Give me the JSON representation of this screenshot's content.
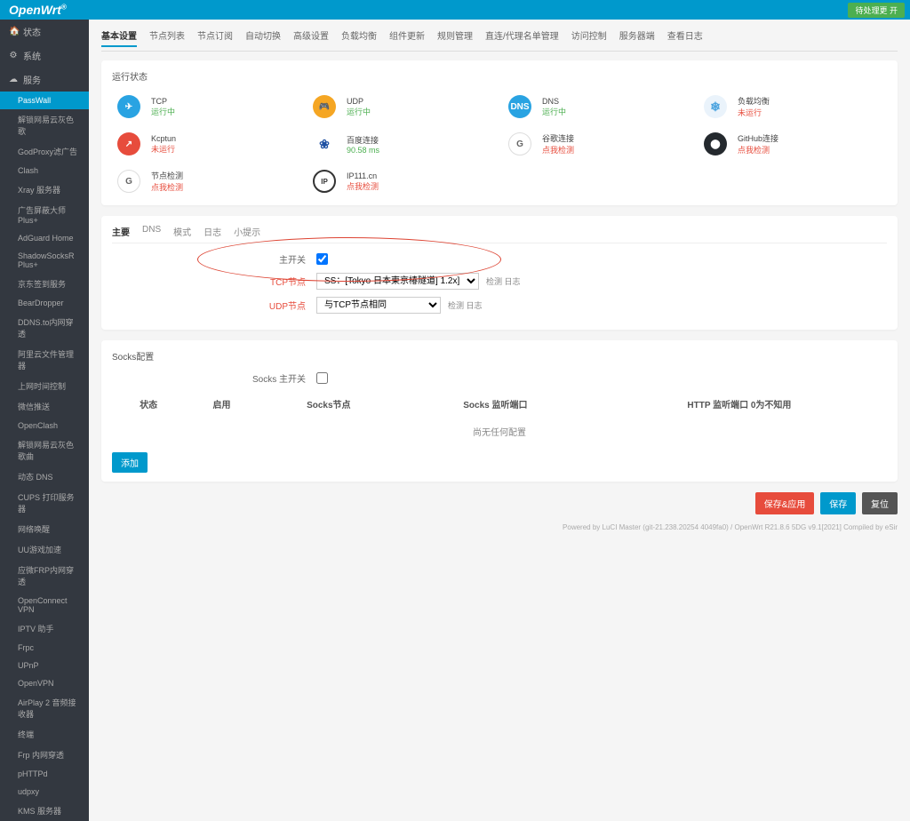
{
  "brand": "OpenWrt",
  "top_button": "待处理更 开",
  "side_cats": [
    {
      "icon": "🏠",
      "label": "状态"
    },
    {
      "icon": "⚙",
      "label": "系统"
    },
    {
      "icon": "☁",
      "label": "服务"
    }
  ],
  "side_subs": [
    "PassWall",
    "解锁网易云灰色歌",
    "GodProxy滤广告",
    "Clash",
    "Xray 服务器",
    "广告屏蔽大师 Plus+",
    "AdGuard Home",
    "ShadowSocksR Plus+",
    "京东签到服务",
    "BearDropper",
    "DDNS.to内网穿透",
    "阿里云文件管理器",
    "上网时间控制",
    "微信推送",
    "OpenClash",
    "解锁网易云灰色歌曲",
    "动态 DNS",
    "CUPS 打印服务器",
    "网络唤醒",
    "UU游戏加速",
    "应微FRP内网穿透",
    "OpenConnect VPN",
    "IPTV 助手",
    "Frpc",
    "UPnP",
    "OpenVPN",
    "AirPlay 2 音频接收器",
    "终端",
    "Frp 内网穿透",
    "pHTTPd",
    "udpxy",
    "KMS 服务器"
  ],
  "active_sub": 0,
  "tabs": [
    "基本设置",
    "节点列表",
    "节点订阅",
    "自动切换",
    "高级设置",
    "负载均衡",
    "组件更新",
    "规则管理",
    "直连/代理名单管理",
    "访问控制",
    "服务器端",
    "查看日志"
  ],
  "status_title": "运行状态",
  "status": [
    {
      "iconText": "✈",
      "cls": "c-blue",
      "t1": "TCP",
      "t2": "运行中",
      "col": "green"
    },
    {
      "iconText": "🎮",
      "cls": "c-orange",
      "t1": "UDP",
      "t2": "运行中",
      "col": "green"
    },
    {
      "iconText": "DNS",
      "cls": "c-blue",
      "t1": "DNS",
      "t2": "运行中",
      "col": "green"
    },
    {
      "iconText": "❄",
      "cls": "c-snow",
      "t1": "负载均衡",
      "t2": "未运行",
      "col": "red"
    },
    {
      "iconText": "↗",
      "cls": "c-red",
      "t1": "Kcptun",
      "t2": "未运行",
      "col": "red"
    },
    {
      "iconText": "❀",
      "cls": "c-paw",
      "t1": "百度连接",
      "t2": "90.58 ms",
      "col": "green"
    },
    {
      "iconText": "G",
      "cls": "c-white",
      "t1": "谷歌连接",
      "t2": "点我检测",
      "col": "red"
    },
    {
      "iconText": "⬤",
      "cls": "c-black",
      "t1": "GitHub连接",
      "t2": "点我检测",
      "col": "red"
    },
    {
      "iconText": "G",
      "cls": "c-white",
      "t1": "节点检测",
      "t2": "点我检测",
      "col": "red"
    },
    {
      "iconText": "IP",
      "cls": "c-ip",
      "t1": "IP111.cn",
      "t2": "点我检测",
      "col": "red"
    }
  ],
  "subtabs": [
    "主要",
    "DNS",
    "模式",
    "日志",
    "小提示"
  ],
  "main_switch_label": "主开关",
  "tcp_label": "TCP节点",
  "tcp_value": "SS：[Tokyo 日本東京椿隧道] 1.2x]",
  "tcp_rhs": "检测  日志",
  "udp_label": "UDP节点",
  "udp_value": "与TCP节点相同",
  "udp_rhs": "检测  日志",
  "socks_title": "Socks配置",
  "socks_switch_label": "Socks 主开关",
  "tbl_heads": [
    "状态",
    "启用",
    "Socks节点",
    "Socks 监听端口",
    "HTTP 监听端口 0为不知用"
  ],
  "tbl_empty": "尚无任何配置",
  "add_btn": "添加",
  "footer": {
    "apply": "保存&应用",
    "save": "保存",
    "reset": "复位"
  },
  "meta": "Powered by LuCI Master (git-21.238.20254 4049fa0) / OpenWrt R21.8.6 5DG v9.1[2021] Compiled by eSir"
}
